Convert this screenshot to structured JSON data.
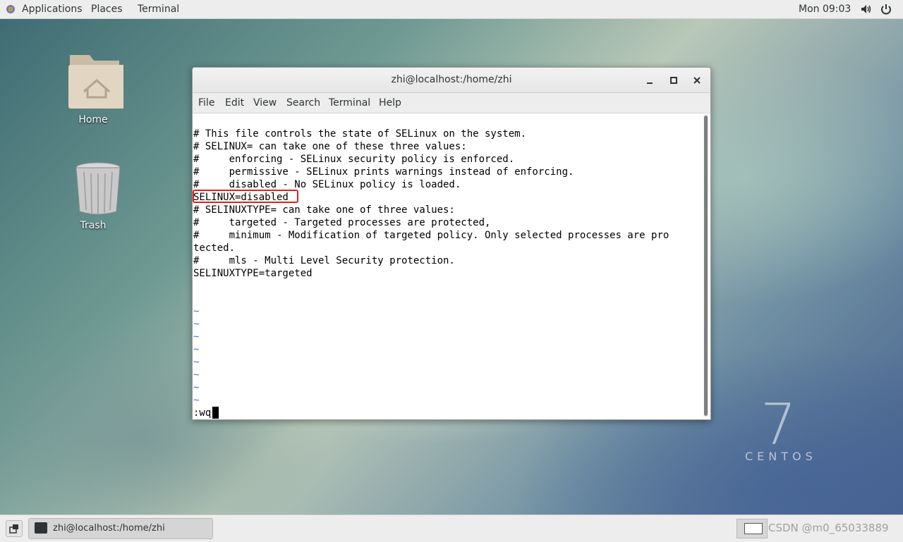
{
  "topbar": {
    "applications": "Applications",
    "places": "Places",
    "terminal": "Terminal",
    "clock": "Mon 09:03",
    "icons": [
      "volume-icon",
      "power-icon"
    ]
  },
  "desktop": {
    "home_label": "Home",
    "trash_label": "Trash"
  },
  "window": {
    "title": "zhi@localhost:/home/zhi",
    "menu": [
      "File",
      "Edit",
      "View",
      "Search",
      "Terminal",
      "Help"
    ],
    "lines": [
      "",
      "# This file controls the state of SELinux on the system.",
      "# SELINUX= can take one of these three values:",
      "#     enforcing - SELinux security policy is enforced.",
      "#     permissive - SELinux prints warnings instead of enforcing.",
      "#     disabled - No SELinux policy is loaded.",
      "SELINUX=disabled",
      "# SELINUXTYPE= can take one of three values:",
      "#     targeted - Targeted processes are protected,",
      "#     minimum - Modification of targeted policy. Only selected processes are pro",
      "tected.",
      "#     mls - Multi Level Security protection.",
      "SELINUXTYPE=targeted"
    ],
    "tildes": [
      "~",
      "~",
      "~",
      "~",
      "~",
      "~",
      "~",
      "~"
    ],
    "command": ":wq"
  },
  "watermark": {
    "version": "7",
    "brand": "CENTOS"
  },
  "taskbar": {
    "task_label": "zhi@localhost:/home/zhi",
    "credit": "CSDN @m0_65033889"
  }
}
